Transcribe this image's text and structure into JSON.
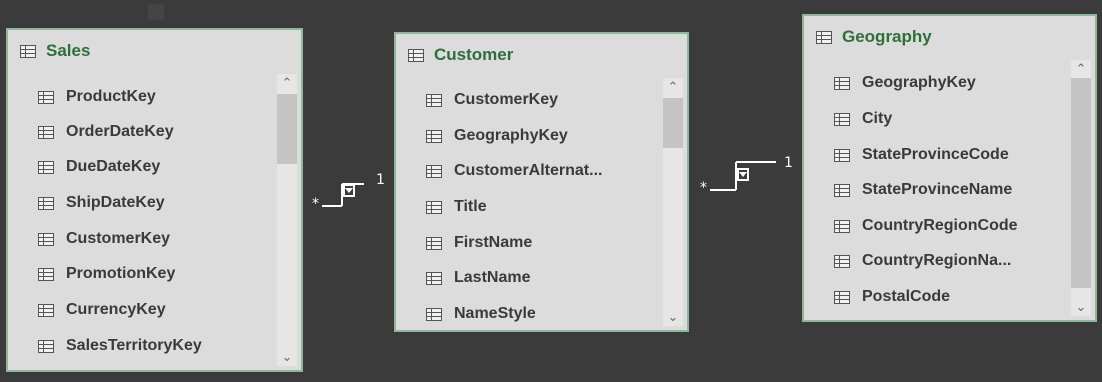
{
  "tables": [
    {
      "title": "Sales",
      "fields": [
        "ProductKey",
        "OrderDateKey",
        "DueDateKey",
        "ShipDateKey",
        "CustomerKey",
        "PromotionKey",
        "CurrencyKey",
        "SalesTerritoryKey"
      ]
    },
    {
      "title": "Customer",
      "fields": [
        "CustomerKey",
        "GeographyKey",
        "CustomerAlternat...",
        "Title",
        "FirstName",
        "LastName",
        "NameStyle"
      ]
    },
    {
      "title": "Geography",
      "fields": [
        "GeographyKey",
        "City",
        "StateProvinceCode",
        "StateProvinceName",
        "CountryRegionCode",
        "CountryRegionNa...",
        "PostalCode"
      ]
    }
  ],
  "relationships": [
    {
      "from": "Sales",
      "to": "Customer",
      "from_cardinality": "*",
      "to_cardinality": "1"
    },
    {
      "from": "Customer",
      "to": "Geography",
      "from_cardinality": "*",
      "to_cardinality": "1"
    }
  ],
  "colors": {
    "background": "#3b3b3b",
    "card": "#dcdcdc",
    "title": "#2f6f3a",
    "border": "#8fb79a"
  }
}
